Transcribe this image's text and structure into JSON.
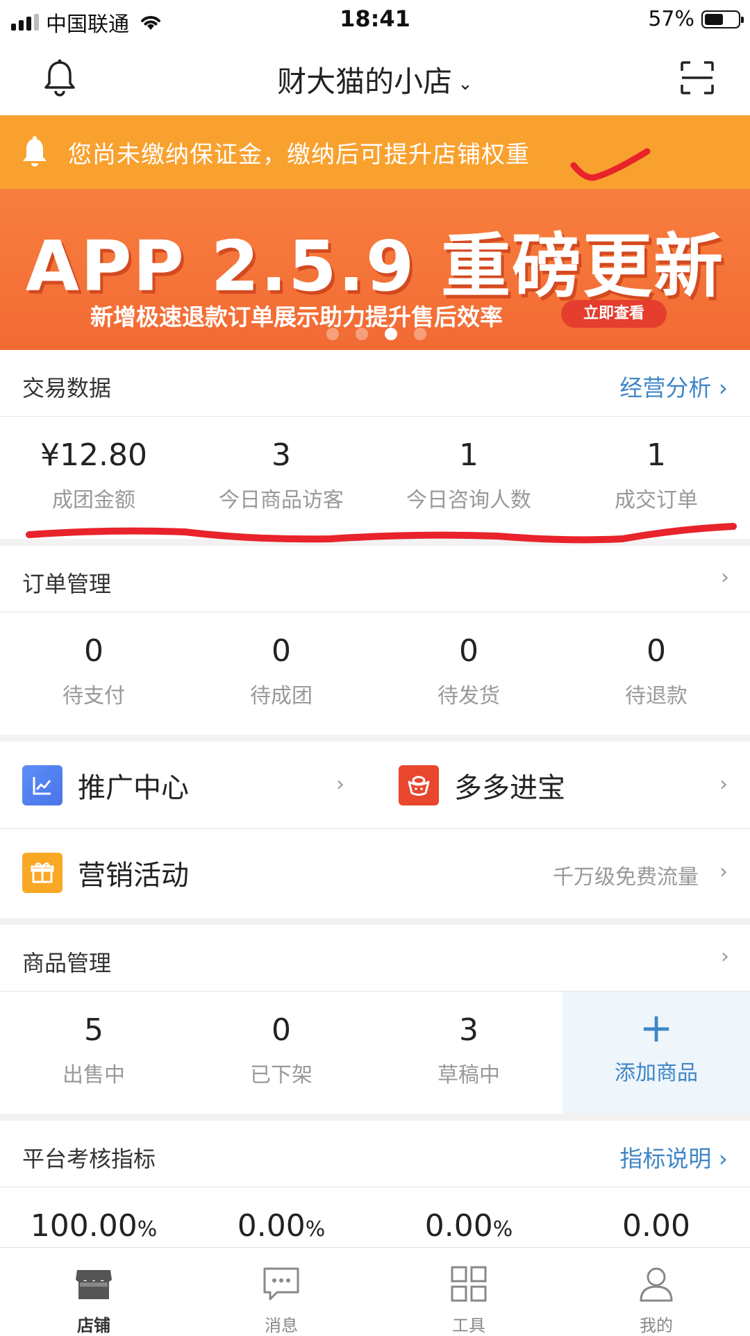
{
  "status_bar": {
    "carrier": "中国联通",
    "time": "18:41",
    "battery": "57%"
  },
  "nav": {
    "store_name": "财大猫的小店",
    "chevron": "⌄"
  },
  "notice": {
    "text": "您尚未缴纳保证金，缴纳后可提升店铺权重"
  },
  "banner": {
    "title": "APP 2.5.9 重磅更新",
    "subtitle": "新增极速退款订单展示助力提升售后效率",
    "button": "立即查看",
    "dots": 4,
    "active_dot": 3
  },
  "trade": {
    "title": "交易数据",
    "link": "经营分析 ›",
    "stats": [
      {
        "value": "¥12.80",
        "label": "成团金额"
      },
      {
        "value": "3",
        "label": "今日商品访客"
      },
      {
        "value": "1",
        "label": "今日咨询人数"
      },
      {
        "value": "1",
        "label": "成交订单"
      }
    ]
  },
  "orders": {
    "title": "订单管理",
    "arrow": "›",
    "stats": [
      {
        "value": "0",
        "label": "待支付"
      },
      {
        "value": "0",
        "label": "待成团"
      },
      {
        "value": "0",
        "label": "待发货"
      },
      {
        "value": "0",
        "label": "待退款"
      }
    ]
  },
  "menus": {
    "promo": {
      "label": "推广中心",
      "arrow": "›"
    },
    "duoduo": {
      "label": "多多进宝",
      "arrow": "›"
    },
    "marketing": {
      "label": "营销活动",
      "sub": "千万级免费流量",
      "arrow": "›"
    }
  },
  "products": {
    "title": "商品管理",
    "arrow": "›",
    "stats": [
      {
        "value": "5",
        "label": "出售中"
      },
      {
        "value": "0",
        "label": "已下架"
      },
      {
        "value": "3",
        "label": "草稿中"
      }
    ],
    "add": {
      "icon": "+",
      "label": "添加商品"
    }
  },
  "metrics": {
    "title": "平台考核指标",
    "link": "指标说明 ›",
    "values": [
      {
        "value": "100.00",
        "unit": "%"
      },
      {
        "value": "0.00",
        "unit": "%"
      },
      {
        "value": "0.00",
        "unit": "%"
      },
      {
        "value": "0.00",
        "unit": ""
      }
    ]
  },
  "tabbar": [
    {
      "label": "店铺",
      "icon": "store-icon",
      "active": true
    },
    {
      "label": "消息",
      "icon": "message-icon",
      "active": false
    },
    {
      "label": "工具",
      "icon": "grid-icon",
      "active": false
    },
    {
      "label": "我的",
      "icon": "user-icon",
      "active": false
    }
  ],
  "colors": {
    "accent_blue": "#3f86c6",
    "notice_orange": "#f9a12f",
    "banner_orange": "#f26a34",
    "annotation_red": "#e8232b"
  }
}
